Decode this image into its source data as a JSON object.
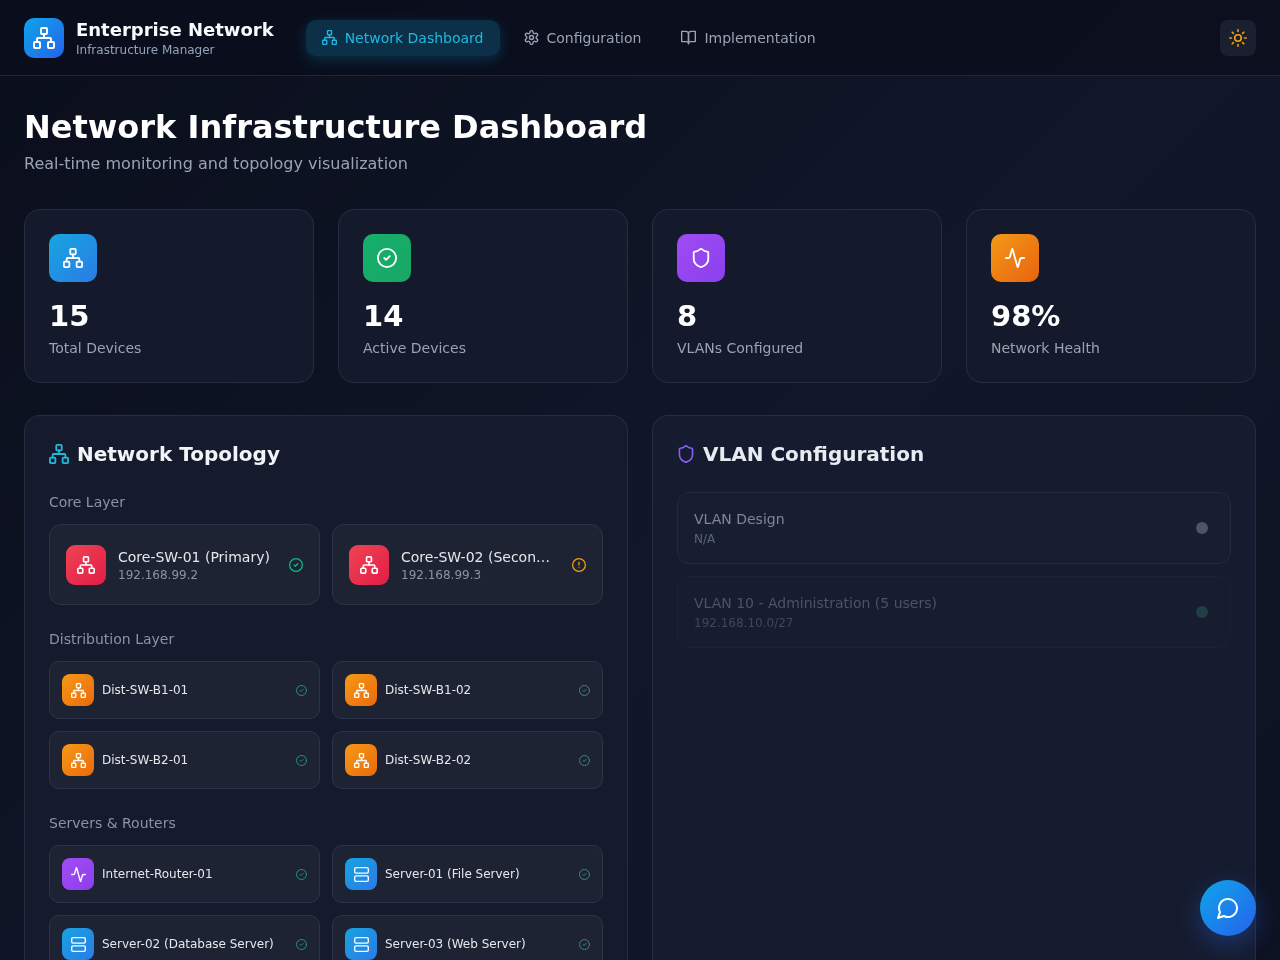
{
  "header": {
    "title": "Enterprise Network",
    "subtitle": "Infrastructure Manager",
    "tabs": [
      {
        "kind": "dashboard",
        "label": "Network Dashboard",
        "selected": true
      },
      {
        "kind": "settings",
        "label": "Configuration",
        "selected": false
      },
      {
        "kind": "guide",
        "label": "Implementation",
        "selected": false
      }
    ]
  },
  "page": {
    "title": "Network Infrastructure Dashboard",
    "subtitle": "Real-time monitoring and topology visualization"
  },
  "stats": [
    {
      "kind": "devices",
      "value": "15",
      "label": "Total Devices"
    },
    {
      "kind": "active",
      "value": "14",
      "label": "Active Devices"
    },
    {
      "kind": "vlans",
      "value": "8",
      "label": "VLANs Configured"
    },
    {
      "kind": "health",
      "value": "98%",
      "label": "Network Health"
    }
  ],
  "topology": {
    "title": "Network Topology",
    "layers": [
      {
        "label": "Core Layer",
        "devices": [
          {
            "kind": "core",
            "name": "Core-SW-01 (Primary)",
            "ip": "192.168.99.2",
            "warning": false
          },
          {
            "kind": "core",
            "name": "Core-SW-02 (Secon…",
            "ip": "192.168.99.3",
            "warning": true
          }
        ]
      },
      {
        "label": "Distribution Layer",
        "devices": [
          {
            "kind": "distribution",
            "name": "Dist-SW-B1-01",
            "warning": false
          },
          {
            "kind": "distribution",
            "name": "Dist-SW-B1-02",
            "warning": false
          },
          {
            "kind": "distribution",
            "name": "Dist-SW-B2-01",
            "warning": false
          },
          {
            "kind": "distribution",
            "name": "Dist-SW-B2-02",
            "warning": false
          }
        ]
      },
      {
        "label": "Servers & Routers",
        "devices": [
          {
            "kind": "router",
            "name": "Internet-Router-01",
            "warning": false
          },
          {
            "kind": "server",
            "name": "Server-01 (File Server)",
            "warning": false
          },
          {
            "kind": "server",
            "name": "Server-02 (Database Server)",
            "warning": false
          },
          {
            "kind": "server",
            "name": "Server-03 (Web Server)",
            "warning": false
          }
        ]
      }
    ]
  },
  "vlan_panel": {
    "title": "VLAN Configuration",
    "items": [
      {
        "name": "VLAN Design",
        "detail": "N/A",
        "color": "#4b5563"
      },
      {
        "name": "VLAN 10 - Administration (5 users)",
        "detail": "192.168.10.0/27",
        "color": "#1f3f47"
      }
    ]
  }
}
